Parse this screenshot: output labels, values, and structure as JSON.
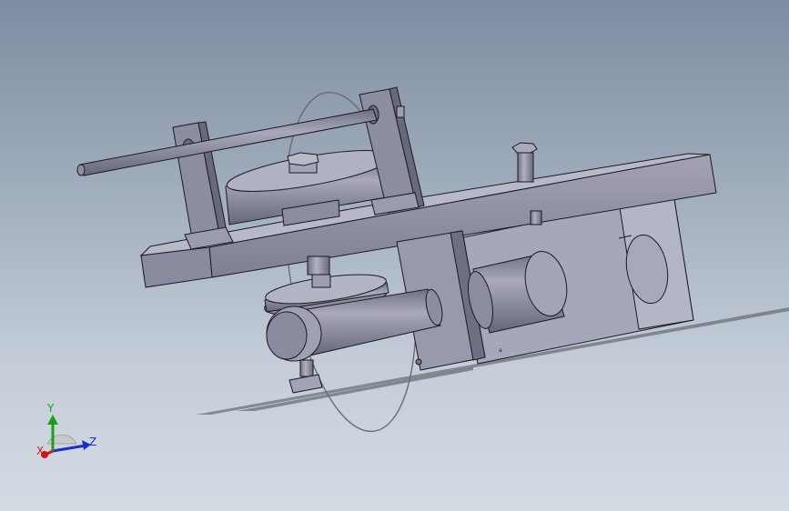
{
  "viewport": {
    "background_top": "#7d8da1",
    "background_bottom": "#d4dbe3",
    "part_color": "#8f8fa3",
    "part_dark": "#5c5c6e",
    "part_light": "#b6b6c6",
    "edge_color": "#1b1b22"
  },
  "triad": {
    "x_label": "X",
    "y_label": "Y",
    "z_label": "Z",
    "x_color": "#d01616",
    "y_color": "#1aa11a",
    "z_color": "#1a2fd0"
  }
}
